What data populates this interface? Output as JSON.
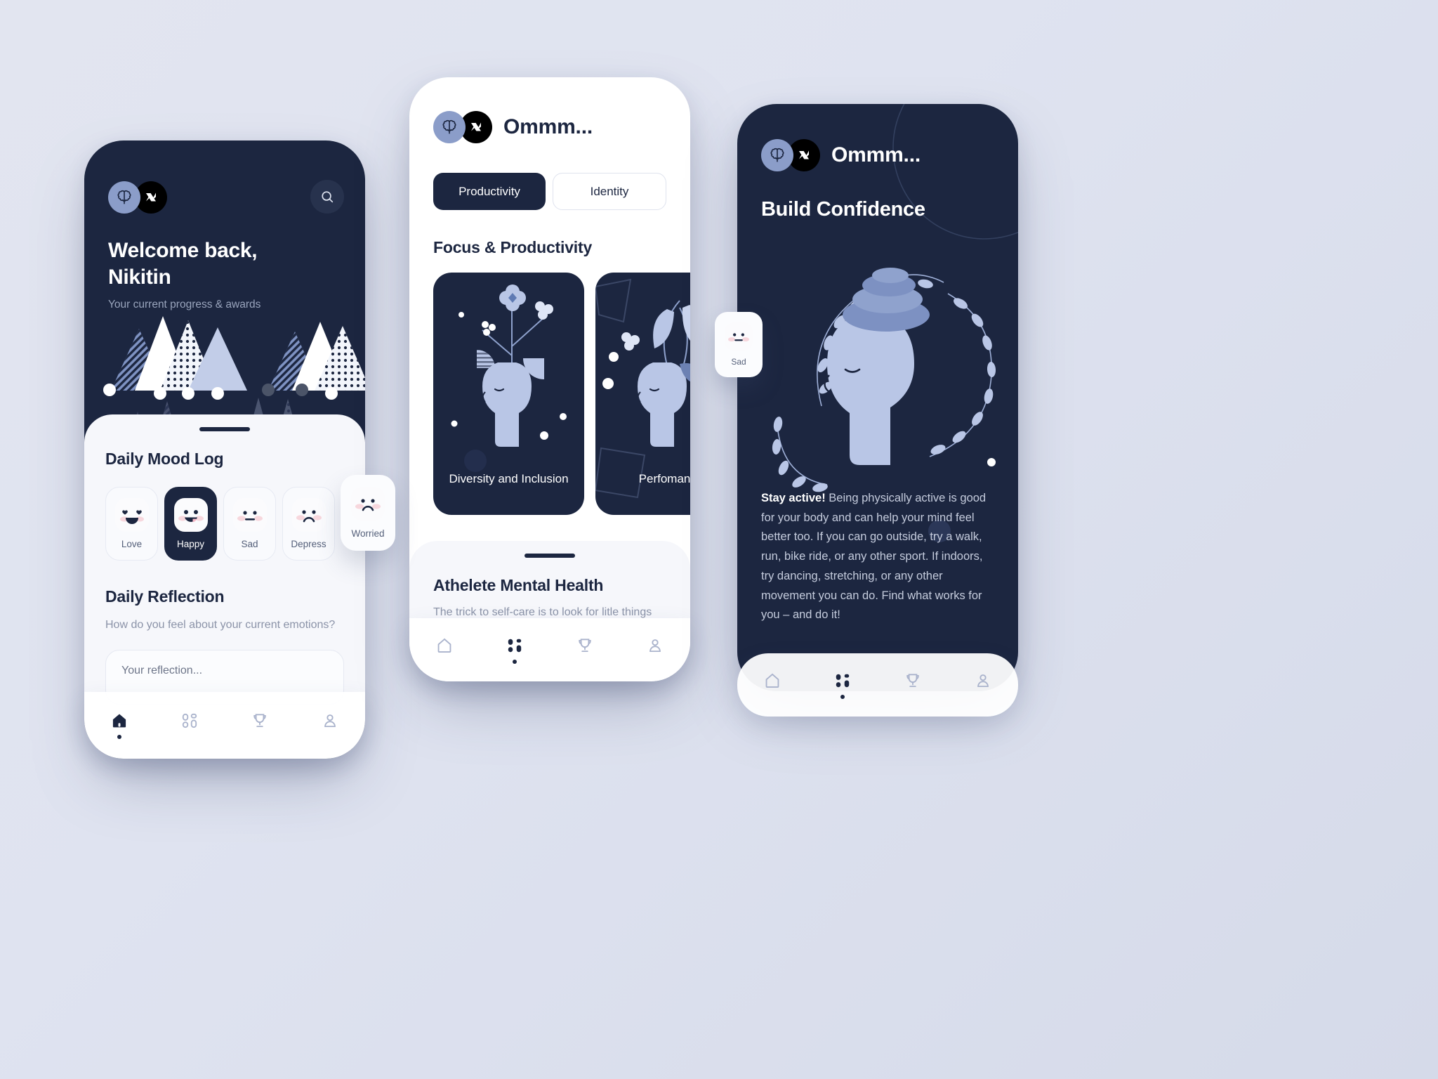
{
  "brand": {
    "name_short": "Ommm...",
    "icon_left": "brain-icon",
    "icon_right": "logo-n-icon"
  },
  "phone1": {
    "search_icon": "search-icon",
    "welcome_line1": "Welcome back,",
    "welcome_line2": "Nikitin",
    "welcome_sub": "Your current progress & awards",
    "mood_log_title": "Daily Mood Log",
    "moods": [
      {
        "label": "Love",
        "face": "heart-eyes-smile",
        "active": false
      },
      {
        "label": "Happy",
        "face": "open-smile",
        "active": true
      },
      {
        "label": "Sad",
        "face": "flat-mouth",
        "active": false
      },
      {
        "label": "Depress",
        "face": "frown",
        "active": false
      }
    ],
    "floating_mood": {
      "label": "Worried",
      "face": "worried-frown"
    },
    "reflection_title": "Daily Reflection",
    "reflection_question": "How do you feel about your current emotions?",
    "reflection_placeholder": "Your reflection...",
    "nav": [
      {
        "name": "home",
        "label": "home-icon",
        "active": true
      },
      {
        "name": "dashboard",
        "label": "grid-icon",
        "active": false
      },
      {
        "name": "awards",
        "label": "trophy-icon",
        "active": false
      },
      {
        "name": "profile",
        "label": "person-icon",
        "active": false
      }
    ]
  },
  "phone2": {
    "title": "Ommm...",
    "tabs": [
      {
        "label": "Productivity",
        "active": true
      },
      {
        "label": "Identity",
        "active": false
      }
    ],
    "section_title": "Focus & Productivity",
    "cards": [
      {
        "label": "Diversity and Inclusion"
      },
      {
        "label": "Perfomance"
      }
    ],
    "sheet_title": "Athelete Mental Health",
    "sheet_sub": "The trick to self-care is to look for litle things",
    "nav": [
      {
        "name": "home",
        "label": "home-icon",
        "active": false
      },
      {
        "name": "dashboard",
        "label": "grid-icon",
        "active": true
      },
      {
        "name": "awards",
        "label": "trophy-icon",
        "active": false
      },
      {
        "name": "profile",
        "label": "person-icon",
        "active": false
      }
    ]
  },
  "phone3": {
    "title": "Ommm...",
    "heading": "Build Confidence",
    "body_bold": "Stay active!",
    "body_text": " Being physically active is good for your body and can help your mind feel better too. If you can go outside, try a walk, run, bike ride, or any other sport. If indoors, try dancing, stretching, or any other movement you can do. Find what works for you – and do it!",
    "floating_mood": {
      "label": "Sad",
      "face": "flat-mouth"
    },
    "nav": [
      {
        "name": "home",
        "label": "home-icon",
        "active": false
      },
      {
        "name": "dashboard",
        "label": "grid-icon",
        "active": true
      },
      {
        "name": "awards",
        "label": "trophy-icon",
        "active": false
      },
      {
        "name": "profile",
        "label": "person-icon",
        "active": false
      }
    ]
  },
  "colors": {
    "dark": "#1c2640",
    "light_sheet": "#f6f7fb",
    "accent_blue": "#8b9dc9",
    "pale_blue": "#c2cde8",
    "muted_text": "#8b93a8",
    "background": "#dfe3f0"
  }
}
